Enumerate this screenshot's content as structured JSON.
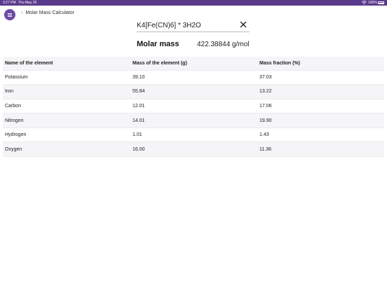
{
  "status_bar": {
    "time": "3:27 PM",
    "date": "Thu May 26",
    "battery": "100%",
    "wifi_icon": "wifi-icon",
    "battery_icon": "battery-icon"
  },
  "header": {
    "menu_icon": "hamburger-icon",
    "breadcrumb_icon": "chevron-right-icon",
    "title": "Molar Mass Calculator"
  },
  "formula": {
    "value": "K4[Fe(CN)6] * 3H2O",
    "clear_icon": "close-icon"
  },
  "result": {
    "label": "Molar mass",
    "value": "422.38844 g/mol"
  },
  "table": {
    "headers": [
      "Name of the element",
      "Mass of the element (g)",
      "Mass fraction (%)"
    ],
    "rows": [
      [
        "Potassium",
        "39.10",
        "37.03"
      ],
      [
        "Iron",
        "55.84",
        "13.22"
      ],
      [
        "Carbon",
        "12.01",
        "17.06"
      ],
      [
        "Nitrogen",
        "14.01",
        "19.90"
      ],
      [
        "Hydrogen",
        "1.01",
        "1.43"
      ],
      [
        "Oxygen",
        "16.00",
        "11.36"
      ]
    ]
  },
  "colors": {
    "accent": "#6d4aa8",
    "status_bar": "#5b3a8c",
    "row_alt": "#f5f5f8"
  }
}
